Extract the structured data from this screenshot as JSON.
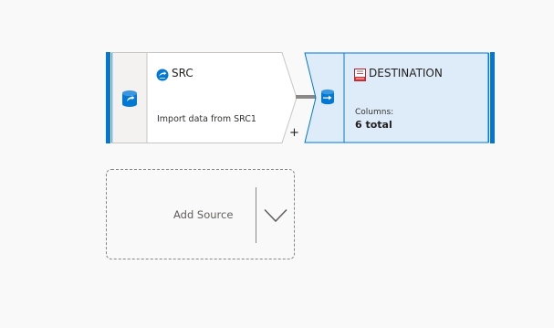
{
  "source_node": {
    "title": "SRC",
    "description": "Import data from SRC1",
    "left_icon": "source-database-icon",
    "title_icon": "source-connector-icon",
    "add_transform_label": "+"
  },
  "destination_node": {
    "title": "DESTINATION",
    "columns_label": "Columns:",
    "columns_value": "6 total",
    "left_icon": "sink-database-icon",
    "title_icon": "destination-table-icon"
  },
  "add_source": {
    "label": "Add Source",
    "dropdown_icon": "chevron-down-icon"
  },
  "colors": {
    "accent": "#0078d4",
    "canvas_background": "#f9f9f9",
    "source_panel": "#ffffff",
    "source_icon_area": "#f3f2f1",
    "destination_panel": "#deecf9",
    "node_border": "#c8c6c4",
    "connector": "#8a8886"
  }
}
